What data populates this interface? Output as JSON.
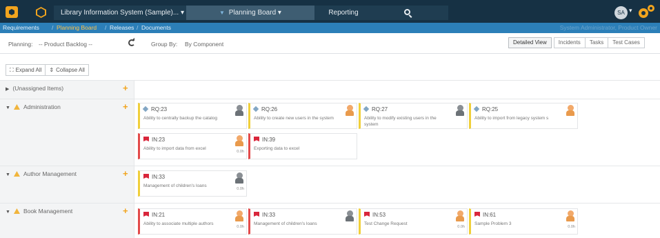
{
  "header": {
    "project": "Library Information System (Sample)...",
    "planning_board": "Planning Board",
    "reporting": "Reporting",
    "user_initials": "SA"
  },
  "breadcrumb": {
    "requirements": "Requirements",
    "planning_board": "Planning Board",
    "releases": "Releases",
    "documents": "Documents",
    "user": "System Administrator, Product Owner"
  },
  "toolbar": {
    "planning_label": "Planning:",
    "planning_value": "-- Product Backlog --",
    "group_by_label": "Group By:",
    "group_by_value": "By Component",
    "views": [
      "Detailed View",
      "Incidents",
      "Tasks",
      "Test Cases"
    ]
  },
  "actions": {
    "expand_all": "Expand All",
    "collapse_all": "Collapse All"
  },
  "rows": [
    {
      "title": "(Unassigned Items)",
      "cards": []
    },
    {
      "title": "Administration",
      "cards": [
        {
          "id": "RQ:23",
          "text": "Ability to centrally backup the catalog",
          "est": ""
        },
        {
          "id": "RQ:26",
          "text": "Ability to create new users in the system",
          "est": ""
        },
        {
          "id": "RQ:27",
          "text": "Ability to modify existing users in the system",
          "est": ""
        },
        {
          "id": "RQ:25",
          "text": "Ability to import from legacy system s",
          "est": ""
        },
        {
          "id": "IN:23",
          "text": "Ability to import data from excel",
          "est": "0.0h"
        },
        {
          "id": "IN:39",
          "text": "Exporting data to excel",
          "est": ""
        }
      ]
    },
    {
      "title": "Author Management",
      "cards": [
        {
          "id": "IN:33",
          "text": "Management of children's loans",
          "est": "0.0h"
        }
      ]
    },
    {
      "title": "Book Management",
      "cards": [
        {
          "id": "IN:21",
          "text": "Ability to associate multiple authors",
          "est": "0.0h"
        },
        {
          "id": "IN:33",
          "text": "Management of children's loans",
          "est": ""
        },
        {
          "id": "IN:53",
          "text": "Test Change Request",
          "est": "0.0h"
        },
        {
          "id": "IN:61",
          "text": "Sample Problem 3",
          "est": "0.0h"
        }
      ]
    }
  ],
  "colors": {
    "navbar": "#163144",
    "crumbbar": "#2c7fb8",
    "accent": "#f1a41e",
    "incident": "#d9263b",
    "requirement": "#f0cf3a"
  }
}
